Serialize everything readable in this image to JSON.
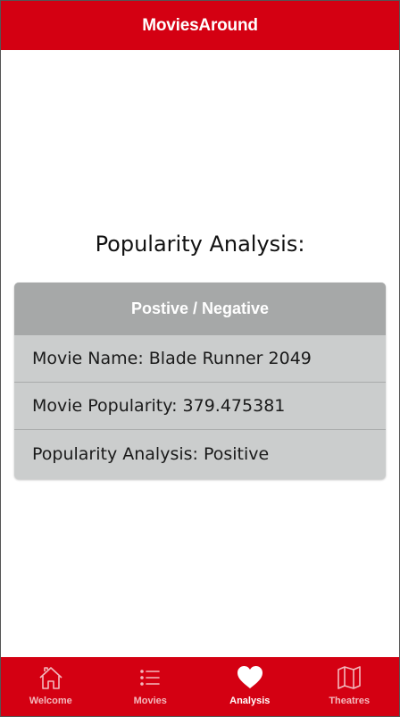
{
  "app": {
    "title": "MoviesAround"
  },
  "main": {
    "title": "Popularity Analysis:",
    "card": {
      "header": "Postive / Negative",
      "rows": [
        {
          "text": "Movie Name: Blade Runner 2049"
        },
        {
          "text": "Movie Popularity: 379.475381"
        },
        {
          "text": "Popularity Analysis: Positive"
        }
      ]
    }
  },
  "tabs": [
    {
      "label": "Welcome",
      "icon": "home-icon",
      "active": false
    },
    {
      "label": "Movies",
      "icon": "list-icon",
      "active": false
    },
    {
      "label": "Analysis",
      "icon": "heart-icon",
      "active": true
    },
    {
      "label": "Theatres",
      "icon": "map-icon",
      "active": false
    }
  ],
  "colors": {
    "brand": "#d40012",
    "card_header": "#a6a8a8",
    "card_body": "#cbcdcd"
  }
}
